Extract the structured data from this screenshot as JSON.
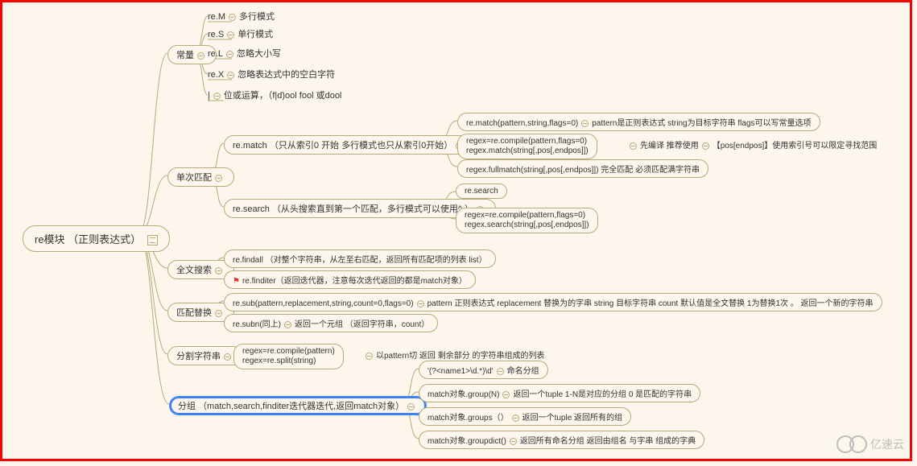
{
  "root": {
    "label": "re模块 （正则表达式）"
  },
  "const": {
    "label": "常量",
    "reM": "re.M",
    "reM_desc": "多行模式",
    "reS": "re.S",
    "reS_desc": "单行模式",
    "reL": "re.L",
    "reL_desc": "忽略大小写",
    "reX": "re.X",
    "reX_desc": "忽略表达式中的空白字符",
    "pipe": "|",
    "pipe_desc": "位或运算，（f|d)ool  fool 或dool"
  },
  "once": {
    "label": "单次匹配",
    "match": {
      "label": "re.match （只从索引0 开始  多行模式也只从索引0开始）",
      "line1": "re.match(pattern,string,flags=0)",
      "line1_desc": "pattern是正则表达式  string为目标字符串  flags可以写常量选项",
      "line2a": "regex=re.compile(pattern,flags=0)",
      "line2b": "regex.match(string[,pos[,endpos]])",
      "line2_desc1": "先编译  推荐使用",
      "line2_desc2": "【pos[endpos]】使用索引号可以限定寻找范围",
      "line3": "regex.fullmatch(string[,pos[,endpos]])  完全匹配  必须匹配满字符串"
    },
    "search": {
      "label": "re.search （从头搜索直到第一个匹配，多行模式可以使用^ ）",
      "line1": "re.search",
      "line2a": "regex=re.compile(pattern,flags=0)",
      "line2b": "regex.search(string[,pos[,endpos]])"
    }
  },
  "full": {
    "label": "全文搜索",
    "findall": "re.findall （对整个字符串，从左至右匹配，返回所有匹配项的列表  list）",
    "finditer": "re.finditer（返回迭代器，注意每次迭代返回的都是match对象）"
  },
  "repl": {
    "label": "匹配替换",
    "sub": "re.sub(pattern,replacement,string,count=0,flags=0)",
    "sub_desc": "pattern 正则表达式  replacement 替换为的字串  string 目标字符串  count 默认值是全文替换  1为替换1次  。 返回一个新的字符串",
    "subn": "re.subn(同上)",
    "subn_desc": "返回一个元组 （返回字符串，count）"
  },
  "split": {
    "label": "分割字符串",
    "l1": "regex=re.compile(pattern)",
    "l2": "regex=re.split(string)",
    "desc": "以pattern切  返回 剩余部分 的字符串组成的列表"
  },
  "group": {
    "label": "分组 （match,search,finditer迭代器迭代,返回match对象）",
    "named": "'(?<name1>\\d.*)\\d'",
    "named_desc": "命名分组",
    "grpN": "match对象.group(N)",
    "grpN_desc": "返回一个tuple   1-N是对应的分组  0 是匹配的字符串",
    "grps": "match对象.groups（）",
    "grps_desc": "返回一个tuple   返回所有的组",
    "gdict": "match对象.groupdict()",
    "gdict_desc": "返回所有命名分组   返回由组名 与字串 组成的字典"
  },
  "logo": "亿速云"
}
